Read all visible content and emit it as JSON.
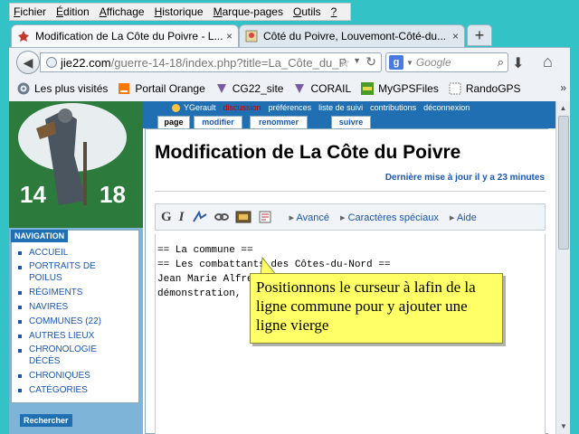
{
  "menubar": {
    "items": [
      {
        "pre": "",
        "key": "F",
        "post": "ichier"
      },
      {
        "pre": "",
        "key": "É",
        "post": "dition"
      },
      {
        "pre": "",
        "key": "A",
        "post": "ffichage"
      },
      {
        "pre": "",
        "key": "H",
        "post": "istorique"
      },
      {
        "pre": "",
        "key": "M",
        "post": "arque-pages"
      },
      {
        "pre": "",
        "key": "O",
        "post": "utils"
      },
      {
        "pre": "",
        "key": "?",
        "post": ""
      }
    ]
  },
  "tabs": [
    {
      "title": "Modification de La Côte du Poivre - L...",
      "close": "×",
      "active": true,
      "favicon": "wiki-icon"
    },
    {
      "title": "Côté du Poivre, Louvemont-Côté-du...",
      "close": "×",
      "active": false,
      "favicon": "map-icon"
    }
  ],
  "newtab_label": "+",
  "nav": {
    "url_host": "jie22.com",
    "url_path": "/guerre-14-18/index.php?title=La_Côte_du_P",
    "search_placeholder": "Google",
    "search_engine": "g"
  },
  "bookmarks": [
    {
      "label": "Les plus visités",
      "icon": "gear-icon",
      "color": "#6b7a8c"
    },
    {
      "label": "Portail Orange",
      "icon": "orange-icon",
      "color": "#ff7900"
    },
    {
      "label": "CG22_site",
      "icon": "cg22-icon",
      "color": "#7a5aa0"
    },
    {
      "label": "CORAIL",
      "icon": "cg22-icon",
      "color": "#7a5aa0"
    },
    {
      "label": "MyGPSFiles",
      "icon": "gps-icon",
      "color": "#4c9a2a"
    },
    {
      "label": "RandoGPS",
      "icon": "blank-page-icon",
      "color": "#ffffff"
    }
  ],
  "wiki": {
    "logo_left": "14",
    "logo_right": "18",
    "userbar": {
      "user": "YGerault",
      "discussion": "discussion",
      "preferences": "préférences",
      "watchlist": "liste de suivi",
      "contributions": "contributions",
      "logout": "déconnexion"
    },
    "page_tabs": [
      "page",
      "modifier",
      "renommer",
      "suivre"
    ],
    "navigation_title": "NAVIGATION",
    "nav_items": [
      "ACCUEIL",
      "PORTRAITS DE POILUS",
      "RÉGIMENTS",
      "NAVIRES",
      "COMMUNES (22)",
      "AUTRES LIEUX",
      "CHRONOLOGIE DÉCÈS",
      "CHRONIQUES",
      "CATÉGORIES"
    ],
    "search_title": "Rechercher",
    "page_title": "Modification de La Côte du Poivre",
    "last_update": "Dernière mise à jour il y a 23 minutes",
    "toolbar": {
      "bold": "G",
      "italic": "I",
      "advanced": "Avancé",
      "special_chars": "Caractères spéciaux",
      "help": "Aide"
    },
    "editor_lines": [
      "== La commune ==",
      "== Les combattants des Côtes-du-Nord ==",
      "Jean Marie Alfred",
      "démonstration,"
    ]
  },
  "callout": {
    "text": "Positionnons le curseur à lafin de la ligne commune pour y ajouter une ligne vierge"
  }
}
